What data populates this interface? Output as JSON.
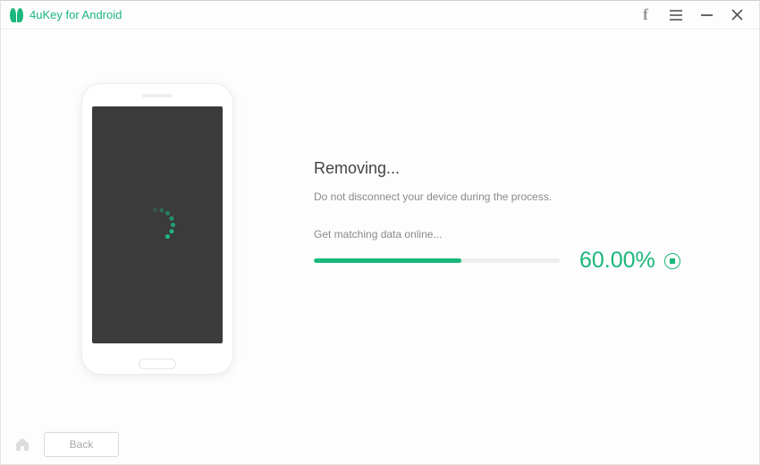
{
  "app": {
    "title": "4uKey for Android"
  },
  "titlebar": {
    "facebook": "f"
  },
  "status": {
    "title": "Removing...",
    "warning": "Do not disconnect your device during the process.",
    "step": "Get matching data online...",
    "percent_value": 60,
    "percent_label": "60.00%"
  },
  "colors": {
    "accent": "#19b77a"
  },
  "bottombar": {
    "back_label": "Back"
  }
}
